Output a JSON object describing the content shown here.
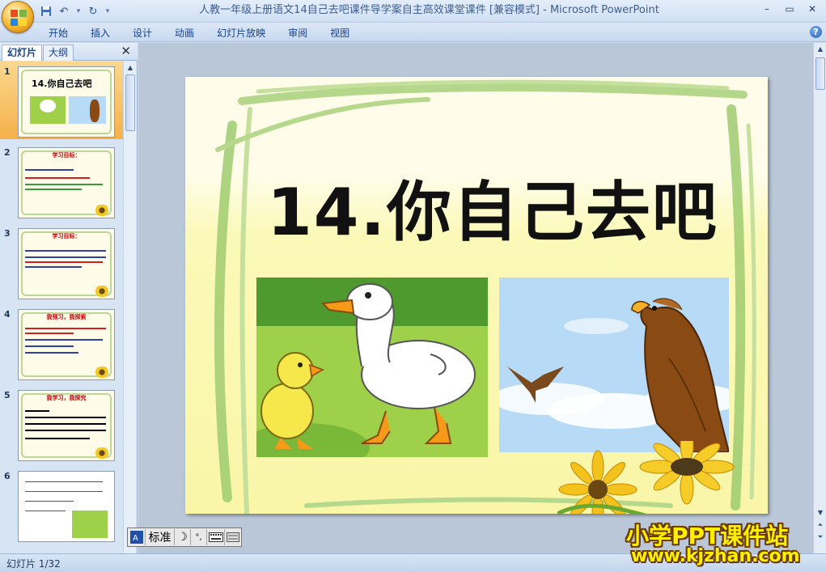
{
  "window": {
    "title": "人教一年级上册语文14自己去吧课件导学案自主高效课堂课件 [兼容模式] - Microsoft PowerPoint",
    "controls": [
      "–",
      "▭",
      "✕"
    ]
  },
  "ribbon": {
    "tabs": [
      "开始",
      "插入",
      "设计",
      "动画",
      "幻灯片放映",
      "审阅",
      "视图"
    ],
    "help": "?"
  },
  "left_panel": {
    "tabs": {
      "slides": "幻灯片",
      "outline": "大纲"
    },
    "close": "✕",
    "thumbnails": [
      {
        "number": "1",
        "title": "14.你自己去吧",
        "selected": true
      },
      {
        "number": "2",
        "title": "学习目标："
      },
      {
        "number": "3",
        "title": "学习目标："
      },
      {
        "number": "4",
        "title": "我预习，我探索"
      },
      {
        "number": "5",
        "title": "我学习，我探究"
      },
      {
        "number": "6"
      }
    ]
  },
  "slide": {
    "title": "14.你自己去吧"
  },
  "ime_bar": {
    "mode": "标准"
  },
  "status": {
    "slide_counter": "幻灯片 1/32"
  },
  "watermark": {
    "line1": "小学PPT课件站",
    "line2": "www.kjzhan.com"
  }
}
